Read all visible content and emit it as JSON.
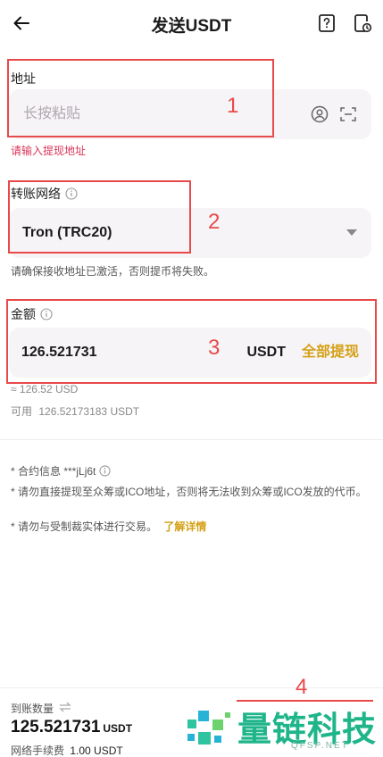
{
  "header": {
    "title": "发送USDT",
    "icons": {
      "back": "arrow-left-icon",
      "faq": "help-document-icon",
      "history": "history-document-icon"
    }
  },
  "address": {
    "label": "地址",
    "placeholder": "长按粘贴",
    "error": "请输入提现地址",
    "icons": {
      "contact": "address-book-icon",
      "scan": "scan-icon"
    }
  },
  "network": {
    "label": "转账网络",
    "value": "Tron (TRC20)",
    "hint": "请确保接收地址已激活，否则提币将失败。"
  },
  "amount": {
    "label": "金额",
    "value": "126.521731",
    "unit": "USDT",
    "withdraw_all": "全部提现",
    "approx": "≈ 126.52 USD",
    "available_label": "可用",
    "available_value": "126.52173183 USDT"
  },
  "annotations": {
    "box1": "1",
    "box2": "2",
    "box3": "3",
    "box4": "4",
    "color": "#e84a4a"
  },
  "notes": {
    "contract": "* 合约信息 ***jLj6t",
    "ico": "* 请勿直接提现至众筹或ICO地址，否则将无法收到众筹或ICO发放的代币。",
    "sanction": "* 请勿与受制裁实体进行交易。",
    "learn_more": "了解详情"
  },
  "footer": {
    "receive_label": "到账数量",
    "receive_amount": "125.521731",
    "receive_unit": "USDT",
    "fee_label": "网络手续费",
    "fee_value": "1.00 USDT"
  },
  "watermark": {
    "text": "量链科技",
    "sub": "QFSP.NET"
  },
  "colors": {
    "accent": "#d4a017",
    "error": "#d9365a",
    "field_bg": "#f6f4f6",
    "watermark": "#1fb58a"
  }
}
